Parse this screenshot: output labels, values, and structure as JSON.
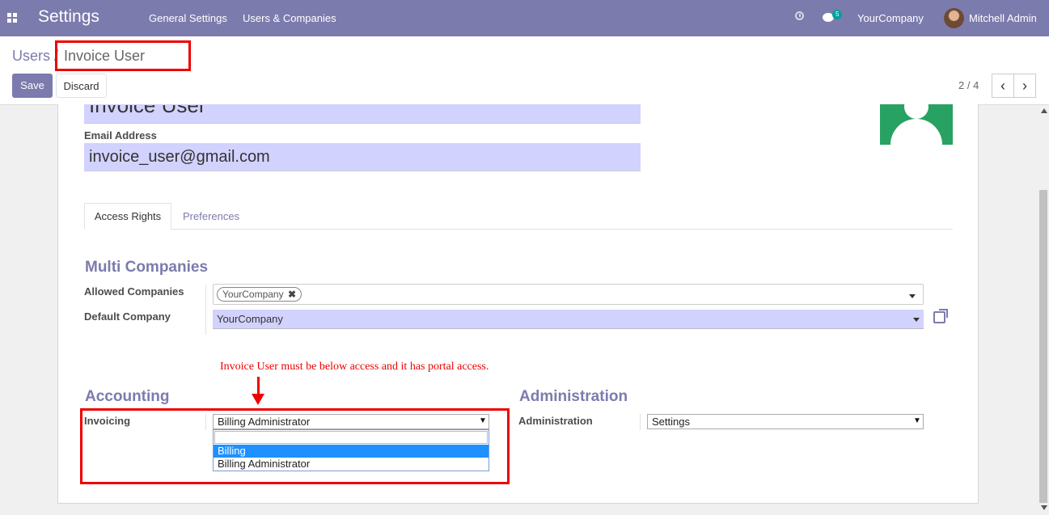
{
  "navbar": {
    "app_title": "Settings",
    "links": [
      "General Settings",
      "Users & Companies"
    ],
    "chat_badge": "5",
    "company": "YourCompany",
    "user": "Mitchell Admin"
  },
  "breadcrumb": {
    "parent": "Users",
    "separator": "/",
    "current": "Invoice User"
  },
  "buttons": {
    "save": "Save",
    "discard": "Discard"
  },
  "pager": {
    "value": "2 / 4",
    "prev": "‹",
    "next": "›"
  },
  "form": {
    "name": "Invoice User",
    "email_label": "Email Address",
    "email": "invoice_user@gmail.com",
    "tabs": [
      "Access Rights",
      "Preferences"
    ],
    "multi_companies": {
      "title": "Multi Companies",
      "allowed_label": "Allowed Companies",
      "allowed_tag": "YourCompany",
      "default_label": "Default Company",
      "default_value": "YourCompany"
    },
    "accounting": {
      "title": "Accounting",
      "invoicing_label": "Invoicing",
      "invoicing_value": "Billing Administrator",
      "options": [
        "Billing",
        "Billing Administrator"
      ]
    },
    "administration": {
      "title": "Administration",
      "label": "Administration",
      "value": "Settings"
    }
  },
  "annotation": {
    "note": "Invoice User must be below access and it has portal access."
  }
}
